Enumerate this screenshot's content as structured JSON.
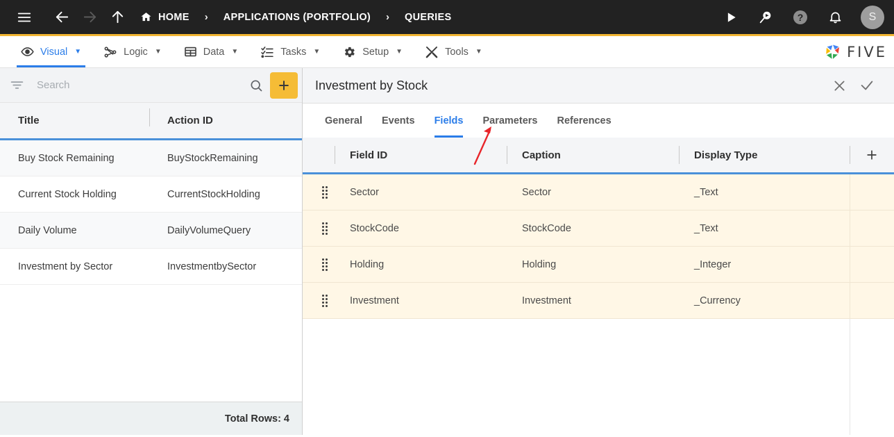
{
  "topbar": {
    "menu_icon": "hamburger-icon",
    "back_icon": "arrow-left-icon",
    "forward_icon": "arrow-right-icon",
    "up_icon": "arrow-up-icon",
    "breadcrumbs": [
      {
        "label": "HOME",
        "icon": "home-icon"
      },
      {
        "label": "APPLICATIONS (PORTFOLIO)"
      },
      {
        "label": "QUERIES"
      }
    ],
    "separator": "›",
    "actions": [
      {
        "name": "run-icon",
        "glyph": "play"
      },
      {
        "name": "search-play-icon",
        "glyph": "search-play"
      },
      {
        "name": "help-icon",
        "glyph": "question"
      },
      {
        "name": "notifications-icon",
        "glyph": "bell"
      }
    ],
    "avatar_initial": "S",
    "accent_color": "#f2b633",
    "background_color": "#222222"
  },
  "menubar": {
    "items": [
      {
        "label": "Visual",
        "icon": "eye-icon",
        "active": true
      },
      {
        "label": "Logic",
        "icon": "logic-nodes-icon",
        "active": false
      },
      {
        "label": "Data",
        "icon": "table-grid-icon",
        "active": false
      },
      {
        "label": "Tasks",
        "icon": "checklist-icon",
        "active": false
      },
      {
        "label": "Setup",
        "icon": "gear-icon",
        "active": false
      },
      {
        "label": "Tools",
        "icon": "tools-icon",
        "active": false
      }
    ],
    "caret": "▼",
    "logo_text": "FIVE",
    "active_color": "#2b7de9"
  },
  "sidebar": {
    "search": {
      "placeholder": "Search",
      "value": ""
    },
    "filter_icon": "filter-icon",
    "search_icon": "search-icon",
    "add_label": "+",
    "columns": [
      "Title",
      "Action ID"
    ],
    "rows": [
      {
        "title": "Buy Stock Remaining",
        "action_id": "BuyStockRemaining"
      },
      {
        "title": "Current Stock Holding",
        "action_id": "CurrentStockHolding"
      },
      {
        "title": "Daily Volume",
        "action_id": "DailyVolumeQuery"
      },
      {
        "title": "Investment by Sector",
        "action_id": "InvestmentbySector"
      }
    ],
    "footer": "Total Rows: 4"
  },
  "main": {
    "title": "Investment by Stock",
    "close_icon": "close-icon",
    "confirm_icon": "check-icon",
    "tabs": [
      {
        "label": "General",
        "active": false
      },
      {
        "label": "Events",
        "active": false
      },
      {
        "label": "Fields",
        "active": true
      },
      {
        "label": "Parameters",
        "active": false
      },
      {
        "label": "References",
        "active": false
      }
    ],
    "grid": {
      "columns": [
        "Field ID",
        "Caption",
        "Display Type"
      ],
      "add_column_label": "+",
      "rows": [
        {
          "field_id": "Sector",
          "caption": "Sector",
          "display_type": "_Text"
        },
        {
          "field_id": "StockCode",
          "caption": "StockCode",
          "display_type": "_Text"
        },
        {
          "field_id": "Holding",
          "caption": "Holding",
          "display_type": "_Integer"
        },
        {
          "field_id": "Investment",
          "caption": "Investment",
          "display_type": "_Currency"
        }
      ],
      "row_background": "#fff7e6",
      "header_underline": "#4a90d9"
    }
  },
  "annotation": {
    "type": "arrow",
    "color": "#e8252a",
    "points_to": "Parameters"
  }
}
